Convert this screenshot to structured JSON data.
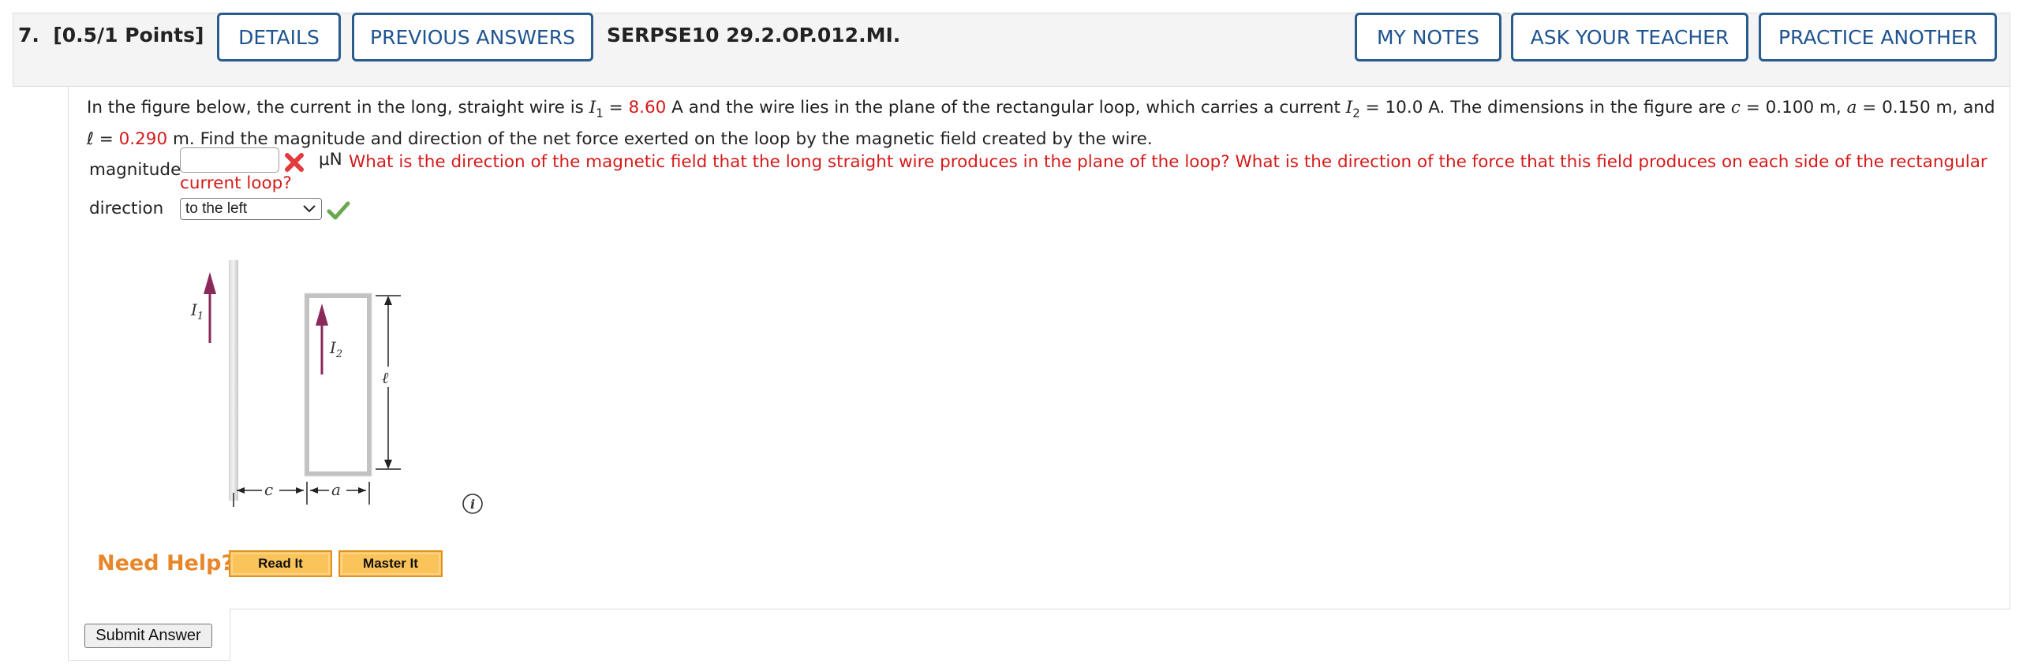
{
  "header": {
    "question_number": "7.",
    "points": "[0.5/1 Points]",
    "details_label": "DETAILS",
    "previous_answers_label": "PREVIOUS ANSWERS",
    "question_id": "SERPSE10 29.2.OP.012.MI.",
    "my_notes_label": "MY NOTES",
    "ask_teacher_label": "ASK YOUR TEACHER",
    "practice_another_label": "PRACTICE ANOTHER"
  },
  "question": {
    "part1": "In the figure below, the current in the long, straight wire is ",
    "I1_symbol": "I",
    "I1_sub": "1",
    "eq1": " = ",
    "I1_value": "8.60",
    "part2": " A and the wire lies in the plane of the rectangular loop, which carries a current ",
    "I2_symbol": "I",
    "I2_sub": "2",
    "part3": " = 10.0 A. The dimensions in the figure are ",
    "c_symbol": "c",
    "part4": " = 0.100 m, ",
    "a_symbol": "a",
    "part5": " = 0.150 m, and",
    "ell_symbol": "ℓ",
    "eq2": " = ",
    "ell_value": "0.290",
    "part6": " m. Find the magnitude and direction of the net force exerted on the loop by the magnetic field created by the wire."
  },
  "answer": {
    "magnitude_label": "magnitude",
    "magnitude_value": "",
    "magnitude_unit": "μN",
    "hint": "What is the direction of the magnetic field that the long straight wire produces in the plane of the loop? What is the direction of the force that this field produces on each side of the rectangular",
    "hint_continued": "current loop?",
    "direction_label": "direction",
    "direction_value": "to the left"
  },
  "figure": {
    "I1": "I",
    "I1_sub": "1",
    "I2": "I",
    "I2_sub": "2",
    "ell": "ℓ",
    "c": "c",
    "a": "a"
  },
  "help": {
    "need_help_label": "Need Help?",
    "read_it_label": "Read It",
    "master_it_label": "Master It"
  },
  "submit_label": "Submit Answer",
  "colors": {
    "accent_blue": "#1f5490",
    "error_red": "#d61a1a",
    "success_green": "#6aa84f",
    "help_orange": "#e8862a",
    "arrow_maroon": "#8b2a5a"
  },
  "icons": {
    "incorrect": "x-mark-icon",
    "correct": "checkmark-icon",
    "info": "info-icon",
    "dropdown": "chevron-down-icon"
  }
}
